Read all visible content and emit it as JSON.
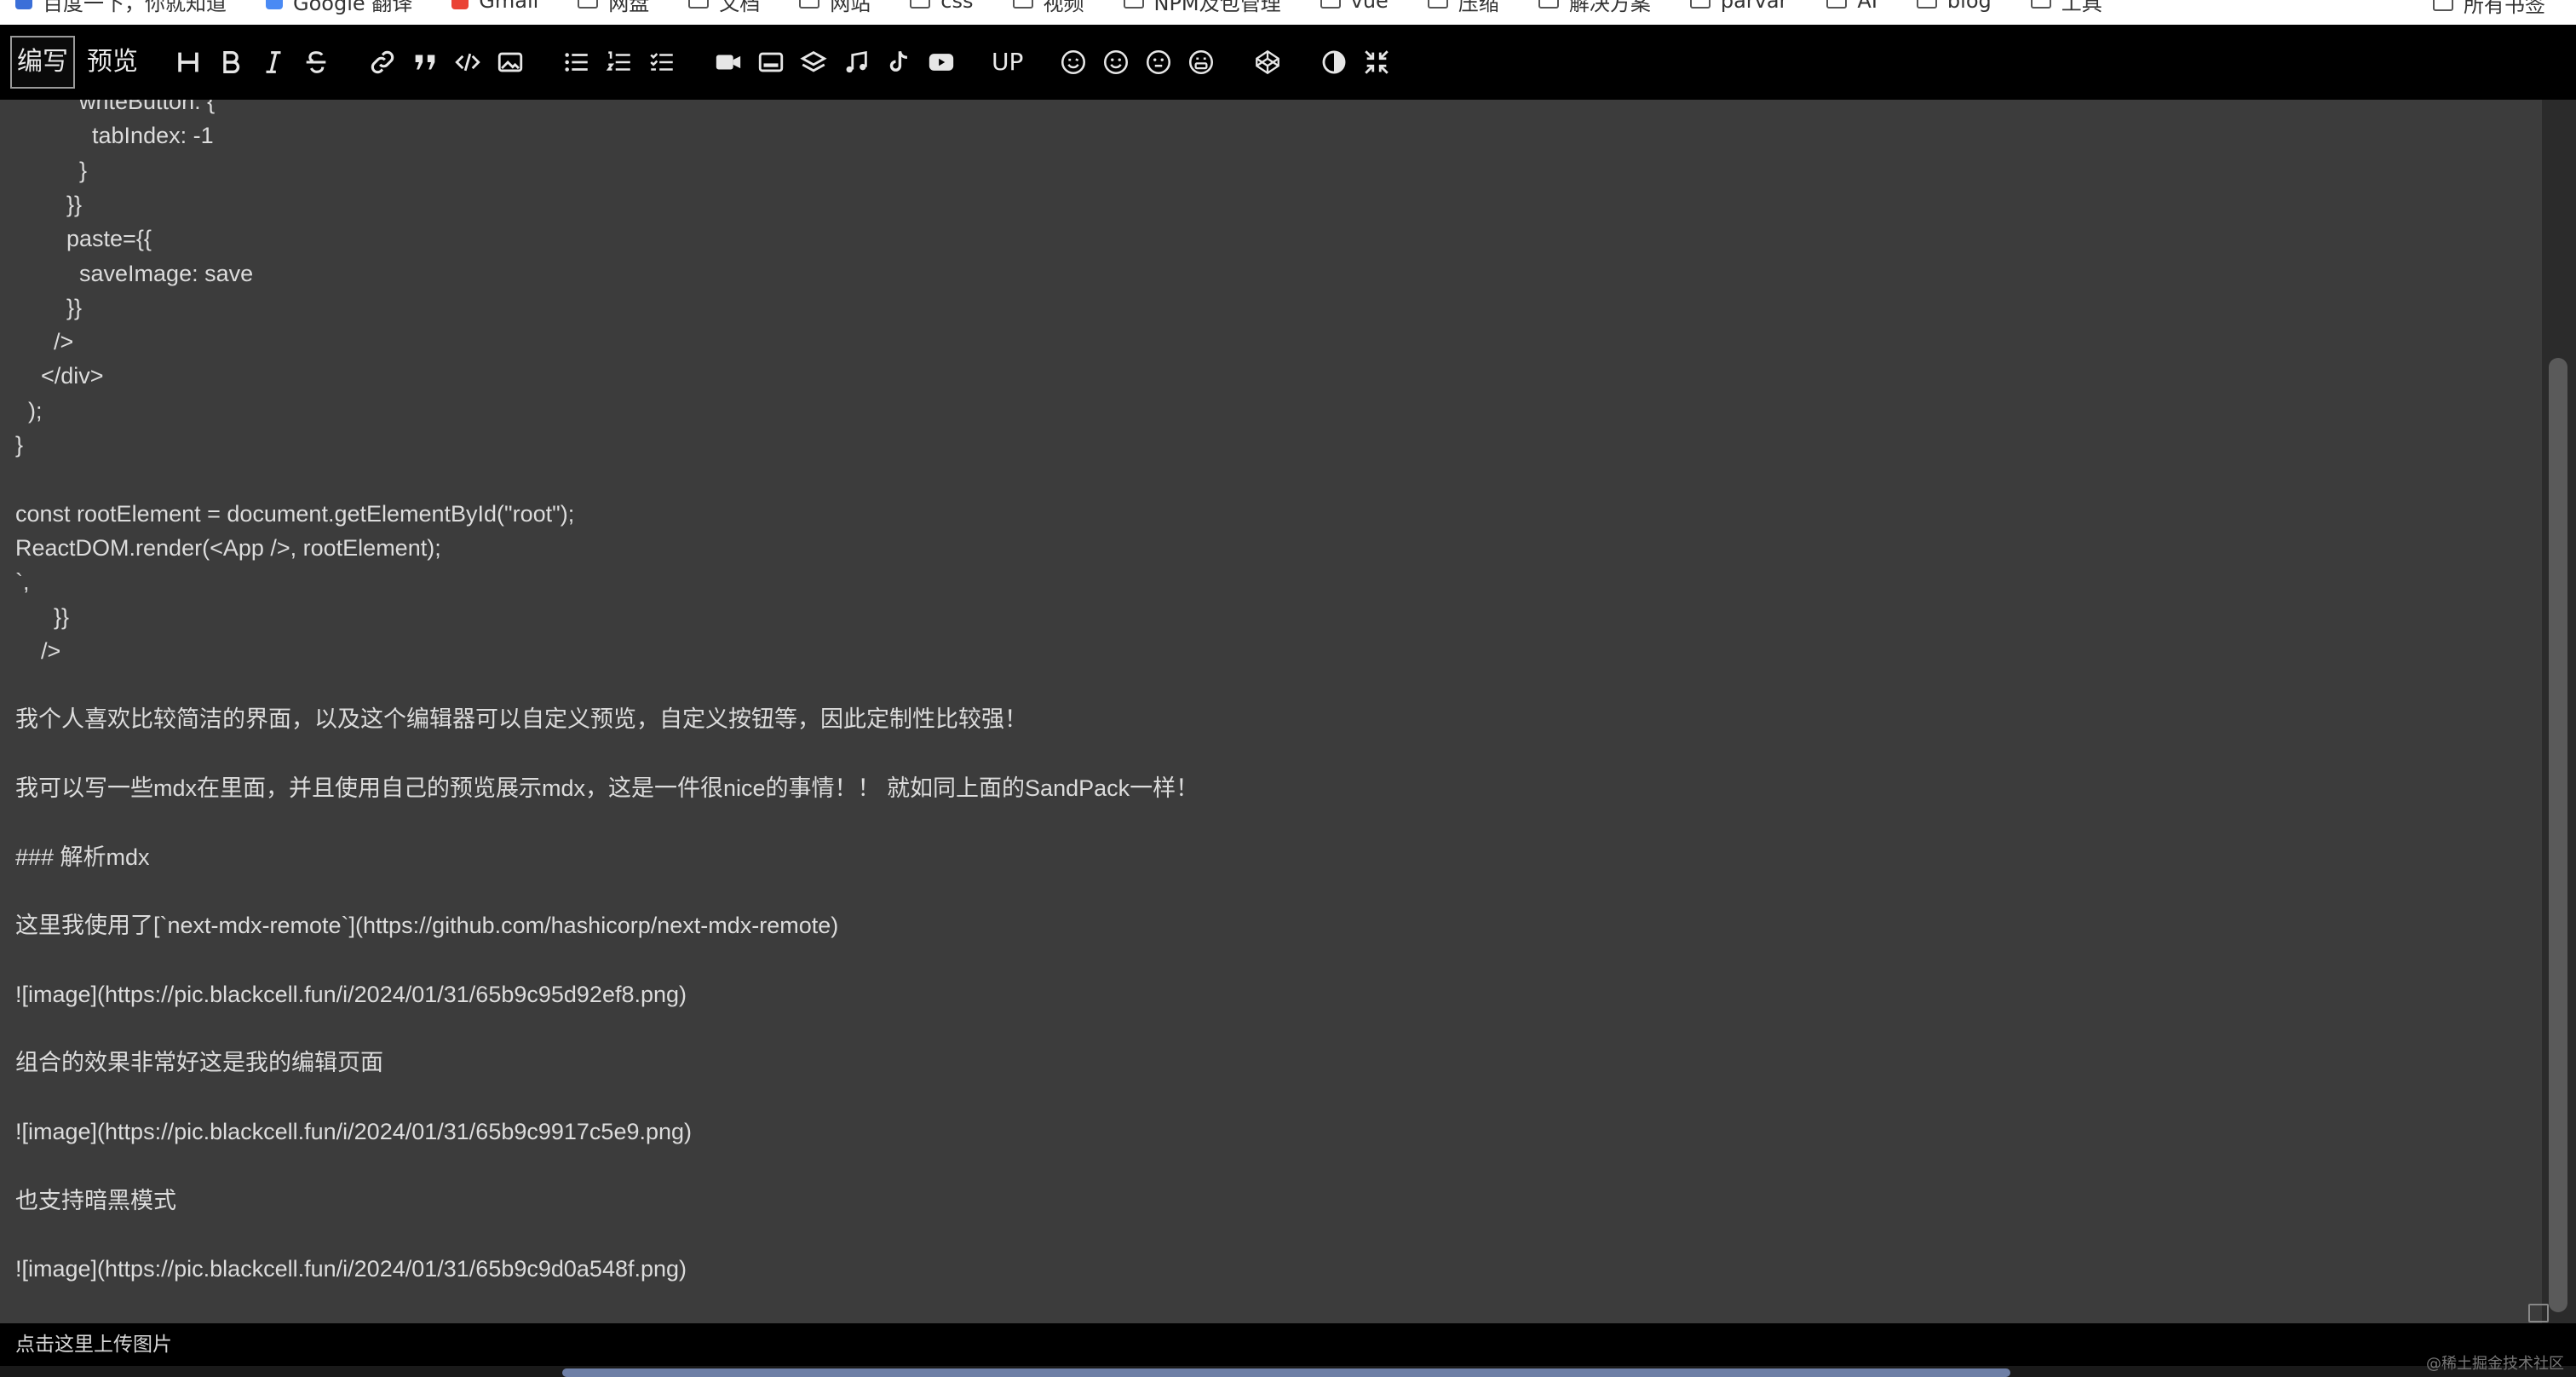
{
  "bookmarks": {
    "items": [
      {
        "label": "百度一下，你就知道",
        "icon": "baidu-favicon"
      },
      {
        "label": "Google 翻译",
        "icon": "google-translate-favicon"
      },
      {
        "label": "Gmail",
        "icon": "gmail-favicon"
      },
      {
        "label": "网盘",
        "icon": "folder-icon"
      },
      {
        "label": "文档",
        "icon": "folder-icon"
      },
      {
        "label": "网站",
        "icon": "folder-icon"
      },
      {
        "label": "css",
        "icon": "folder-icon"
      },
      {
        "label": "视频",
        "icon": "folder-icon"
      },
      {
        "label": "NPM及包管理",
        "icon": "folder-icon"
      },
      {
        "label": "vue",
        "icon": "folder-icon"
      },
      {
        "label": "压缩",
        "icon": "folder-icon"
      },
      {
        "label": "解决方案",
        "icon": "folder-icon"
      },
      {
        "label": "parvar",
        "icon": "folder-icon"
      },
      {
        "label": "AI",
        "icon": "folder-icon"
      },
      {
        "label": "blog",
        "icon": "folder-icon"
      },
      {
        "label": "工具",
        "icon": "folder-icon"
      }
    ],
    "all_bookmarks": "所有书签"
  },
  "toolbar": {
    "write_label": "编写",
    "preview_label": "预览",
    "up_label": "UP"
  },
  "editor": {
    "lines": [
      "          writeButton: {",
      "            tabIndex: -1",
      "          }",
      "        }}",
      "        paste={{",
      "          saveImage: save",
      "        }}",
      "      />",
      "    </div>",
      "  );",
      "}",
      "",
      "const rootElement = document.getElementById(\"root\");",
      "ReactDOM.render(<App />, rootElement);",
      "`,",
      "      }}",
      "    />",
      "",
      "我个人喜欢比较简洁的界面，以及这个编辑器可以自定义预览，自定义按钮等，因此定制性比较强！",
      "",
      "我可以写一些mdx在里面，并且使用自己的预览展示mdx，这是一件很nice的事情！！ 就如同上面的SandPack一样！",
      "",
      "### 解析mdx",
      "",
      "这里我使用了[`next-mdx-remote`](https://github.com/hashicorp/next-mdx-remote)",
      "",
      "![image](https://pic.blackcell.fun/i/2024/01/31/65b9c95d92ef8.png)",
      "",
      "组合的效果非常好这是我的编辑页面",
      "",
      "![image](https://pic.blackcell.fun/i/2024/01/31/65b9c9917c5e9.png)",
      "",
      "也支持暗黑模式",
      "",
      "![image](https://pic.blackcell.fun/i/2024/01/31/65b9c9d0a548f.png)"
    ]
  },
  "footer": {
    "upload_hint": "点击这里上传图片"
  },
  "watermark": "@稀土掘金技术社区"
}
